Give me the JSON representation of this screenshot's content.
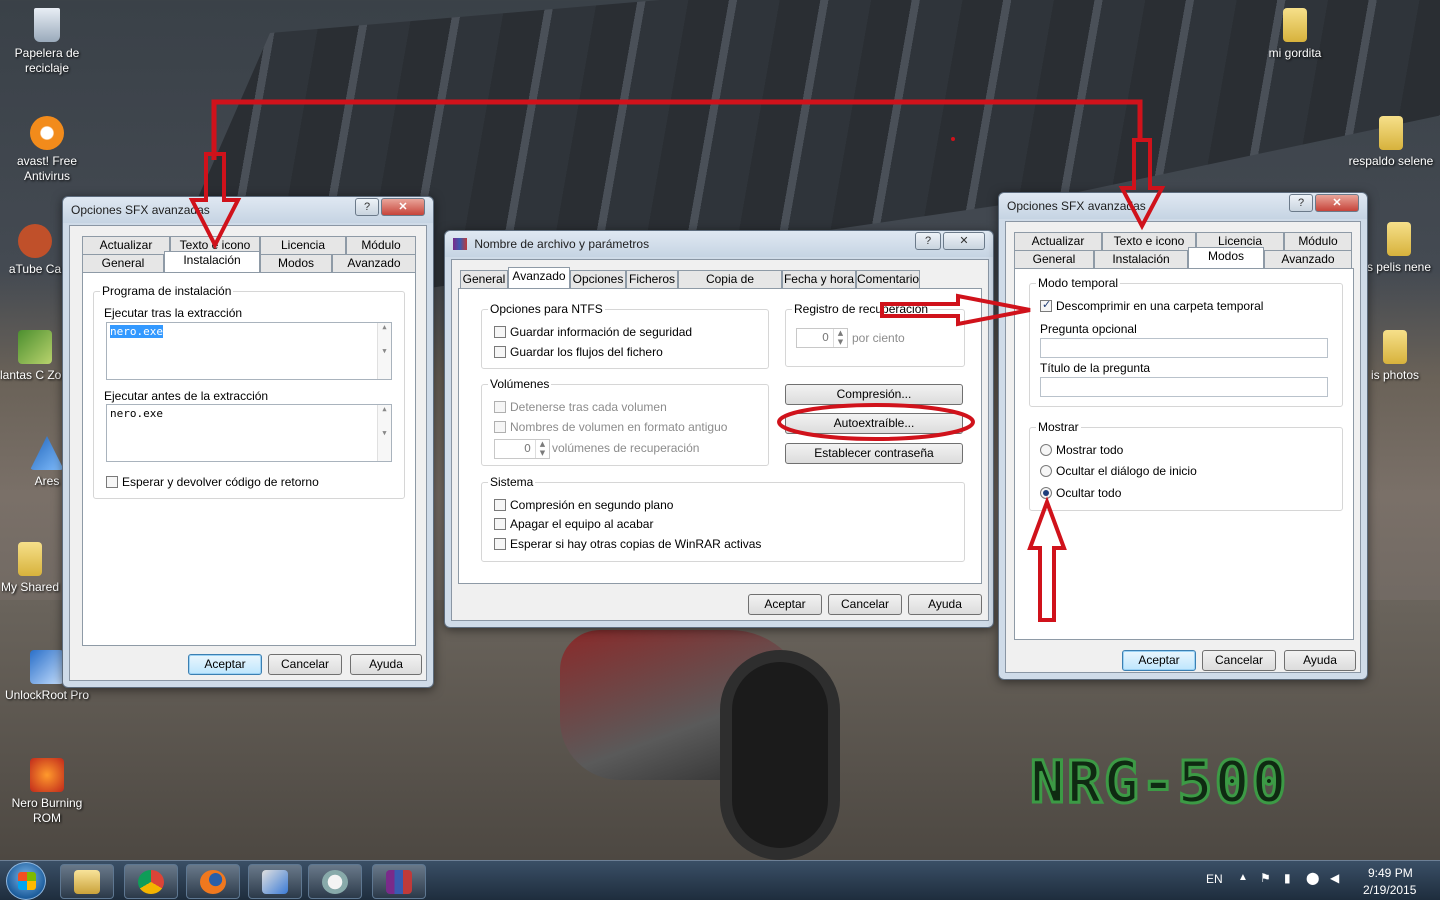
{
  "desktop": {
    "icons_left": [
      {
        "label": "Papelera de reciclaje",
        "icon": "recycle-bin-icon"
      },
      {
        "label": "avast! Free Antivirus",
        "icon": "avast-icon"
      },
      {
        "label": "aTube Ca",
        "icon": "atube-icon"
      },
      {
        "label": "Plantas C Zomb",
        "icon": "plants-zombies-icon"
      },
      {
        "label": "Ares",
        "icon": "ares-icon"
      },
      {
        "label": "My Shared",
        "icon": "folder-icon"
      },
      {
        "label": "UnlockRoot Pro",
        "icon": "unlockroot-icon"
      },
      {
        "label": "Nero Burning ROM",
        "icon": "nero-icon"
      }
    ],
    "icons_right": [
      {
        "label": "mi gordita",
        "icon": "folder-icon"
      },
      {
        "label": "respaldo selene",
        "icon": "folder-icon"
      },
      {
        "label": "s pelis nene",
        "icon": "folder-icon"
      },
      {
        "label": "is photos",
        "icon": "folder-icon"
      }
    ],
    "watermark": "NRG-500"
  },
  "win_left": {
    "title": "Opciones SFX avanzadas",
    "help": "?",
    "close": "✕",
    "tabs_row1": [
      "Actualizar",
      "Texto e icono",
      "Licencia",
      "Módulo"
    ],
    "tabs_row2": [
      "General",
      "Instalación",
      "Modos",
      "Avanzado"
    ],
    "selected_tab": "Instalación",
    "group_title": "Programa de instalación",
    "run_after_label": "Ejecutar tras la extracción",
    "run_after_value": "nero.exe",
    "run_before_label": "Ejecutar antes de la extracción",
    "run_before_value": "nero.exe",
    "wait_label": "Esperar y devolver código de retorno",
    "ok": "Aceptar",
    "cancel": "Cancelar",
    "help_btn": "Ayuda"
  },
  "win_mid": {
    "title": "Nombre de archivo y parámetros",
    "help": "?",
    "close": "✕",
    "tabs": [
      "General",
      "Avanzado",
      "Opciones",
      "Ficheros",
      "Copia de seguridad",
      "Fecha y hora",
      "Comentario"
    ],
    "selected_tab": "Avanzado",
    "ntfs_title": "Opciones para NTFS",
    "ntfs_opt1": "Guardar información de seguridad",
    "ntfs_opt2": "Guardar los flujos del fichero",
    "recovery_title": "Registro de recuperación",
    "recovery_value": "0",
    "recovery_unit": "por ciento",
    "volumes_title": "Volúmenes",
    "vol_opt1": "Detenerse tras cada volumen",
    "vol_opt2": "Nombres de volumen en formato antiguo",
    "vol_recovery_value": "0",
    "vol_recovery_label": "volúmenes de recuperación",
    "btn_compression": "Compresión...",
    "btn_sfx": "Autoextraíble...",
    "btn_password": "Establecer contraseña",
    "system_title": "Sistema",
    "sys_opt1": "Compresión en segundo plano",
    "sys_opt2": "Apagar el equipo al acabar",
    "sys_opt3": "Esperar si hay otras copias de WinRAR activas",
    "ok": "Aceptar",
    "cancel": "Cancelar",
    "help_btn": "Ayuda"
  },
  "win_right": {
    "title": "Opciones SFX avanzadas",
    "help": "?",
    "close": "✕",
    "tabs_row1": [
      "Actualizar",
      "Texto e icono",
      "Licencia",
      "Módulo"
    ],
    "tabs_row2": [
      "General",
      "Instalación",
      "Modos",
      "Avanzado"
    ],
    "selected_tab": "Modos",
    "temp_title": "Modo temporal",
    "temp_opt": "Descomprimir en una carpeta temporal",
    "temp_checked": true,
    "question_label": "Pregunta opcional",
    "question_title_label": "Título de la pregunta",
    "show_title": "Mostrar",
    "show_opt1": "Mostrar todo",
    "show_opt2": "Ocultar el diálogo de inicio",
    "show_opt3": "Ocultar todo",
    "show_selected": "Ocultar todo",
    "ok": "Aceptar",
    "cancel": "Cancelar",
    "help_btn": "Ayuda"
  },
  "taskbar": {
    "items": [
      "explorer-icon",
      "chrome-icon",
      "firefox-icon",
      "network-tool-icon",
      "paint-icon",
      "winrar-icon"
    ],
    "language": "EN",
    "time": "9:49 PM",
    "date": "2/19/2015"
  },
  "annotations": {
    "color": "#d0121b"
  }
}
